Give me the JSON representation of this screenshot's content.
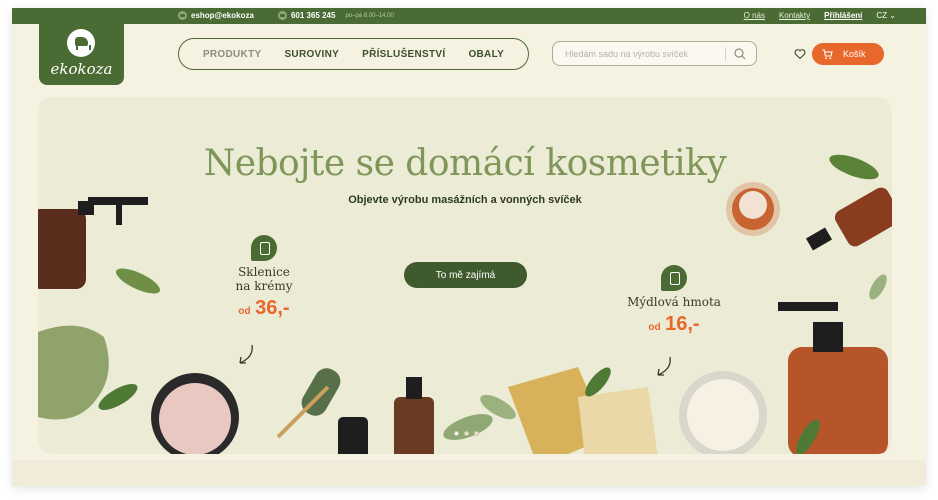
{
  "topbar": {
    "email": "eshop@ekokoza",
    "phone": "601 365 245",
    "hours": "po–pá 8.00–14.00",
    "links": [
      "O nás",
      "Kontakty",
      "Přihlášení"
    ],
    "lang": "CZ"
  },
  "logo": {
    "text": "ekokoza"
  },
  "nav": {
    "items": [
      "PRODUKTY",
      "SUROVINY",
      "PŘÍSLUŠENSTVÍ",
      "OBALY"
    ]
  },
  "search": {
    "placeholder": "Hledám sadu na výrobu svíček"
  },
  "cart": {
    "label": "Košík"
  },
  "hero": {
    "title": "Nebojte se domácí kosmetiky",
    "subtitle": "Objevte výrobu masážních a vonných svíček",
    "cta": "To mě zajímá",
    "promo_left": {
      "line1": "Sklenice",
      "line2": "na krémy",
      "od": "od",
      "price": "36,-"
    },
    "promo_right": {
      "line1": "Mýdlová hmota",
      "od": "od",
      "price": "16,-"
    }
  },
  "colors": {
    "brand_green": "#4a6b34",
    "accent_orange": "#e8672a",
    "title_green": "#7f9659",
    "background": "#f6f2e2"
  },
  "icons": [
    "phone-icon",
    "email-icon",
    "search-icon",
    "heart-icon",
    "cart-icon",
    "goat-logo-icon",
    "arrow-icon"
  ]
}
